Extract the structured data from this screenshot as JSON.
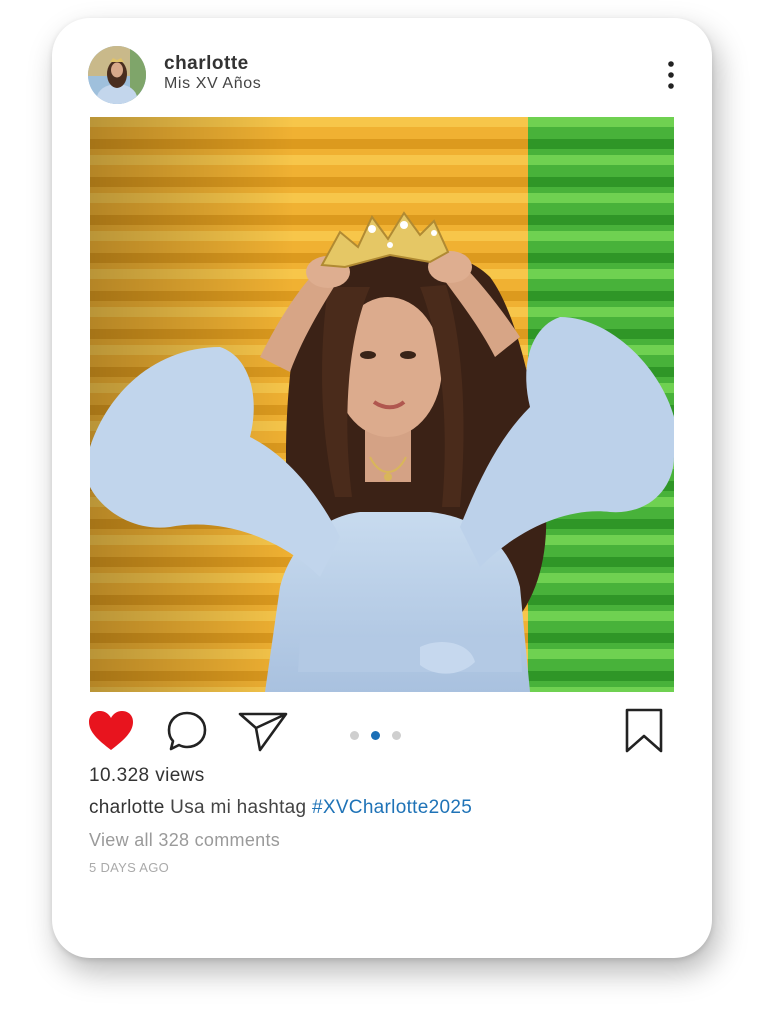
{
  "post": {
    "username": "charlotte",
    "location": "Mis XV Años",
    "views": "10.328 views",
    "caption_user": "charlotte",
    "caption_text": "Usa mi hashtag",
    "caption_hashtag": "#XVCharlotte2025",
    "comments_link": "View all 328 comments",
    "time_ago": "5 DAYS AGO",
    "carousel": {
      "count": 3,
      "active_index": 1
    },
    "liked": true
  },
  "icons": {
    "like": "heart-icon",
    "comment": "comment-icon",
    "share": "send-icon",
    "save": "bookmark-icon",
    "more": "more-vertical-icon"
  },
  "colors": {
    "like": "#e8141e",
    "hashtag": "#1f73b7",
    "carousel_active": "#1b6fb6",
    "carousel_inactive": "#cfcfcf",
    "wall_yellow": "#f2b632",
    "wall_green": "#4bb43a",
    "dress": "#b8cde6"
  }
}
